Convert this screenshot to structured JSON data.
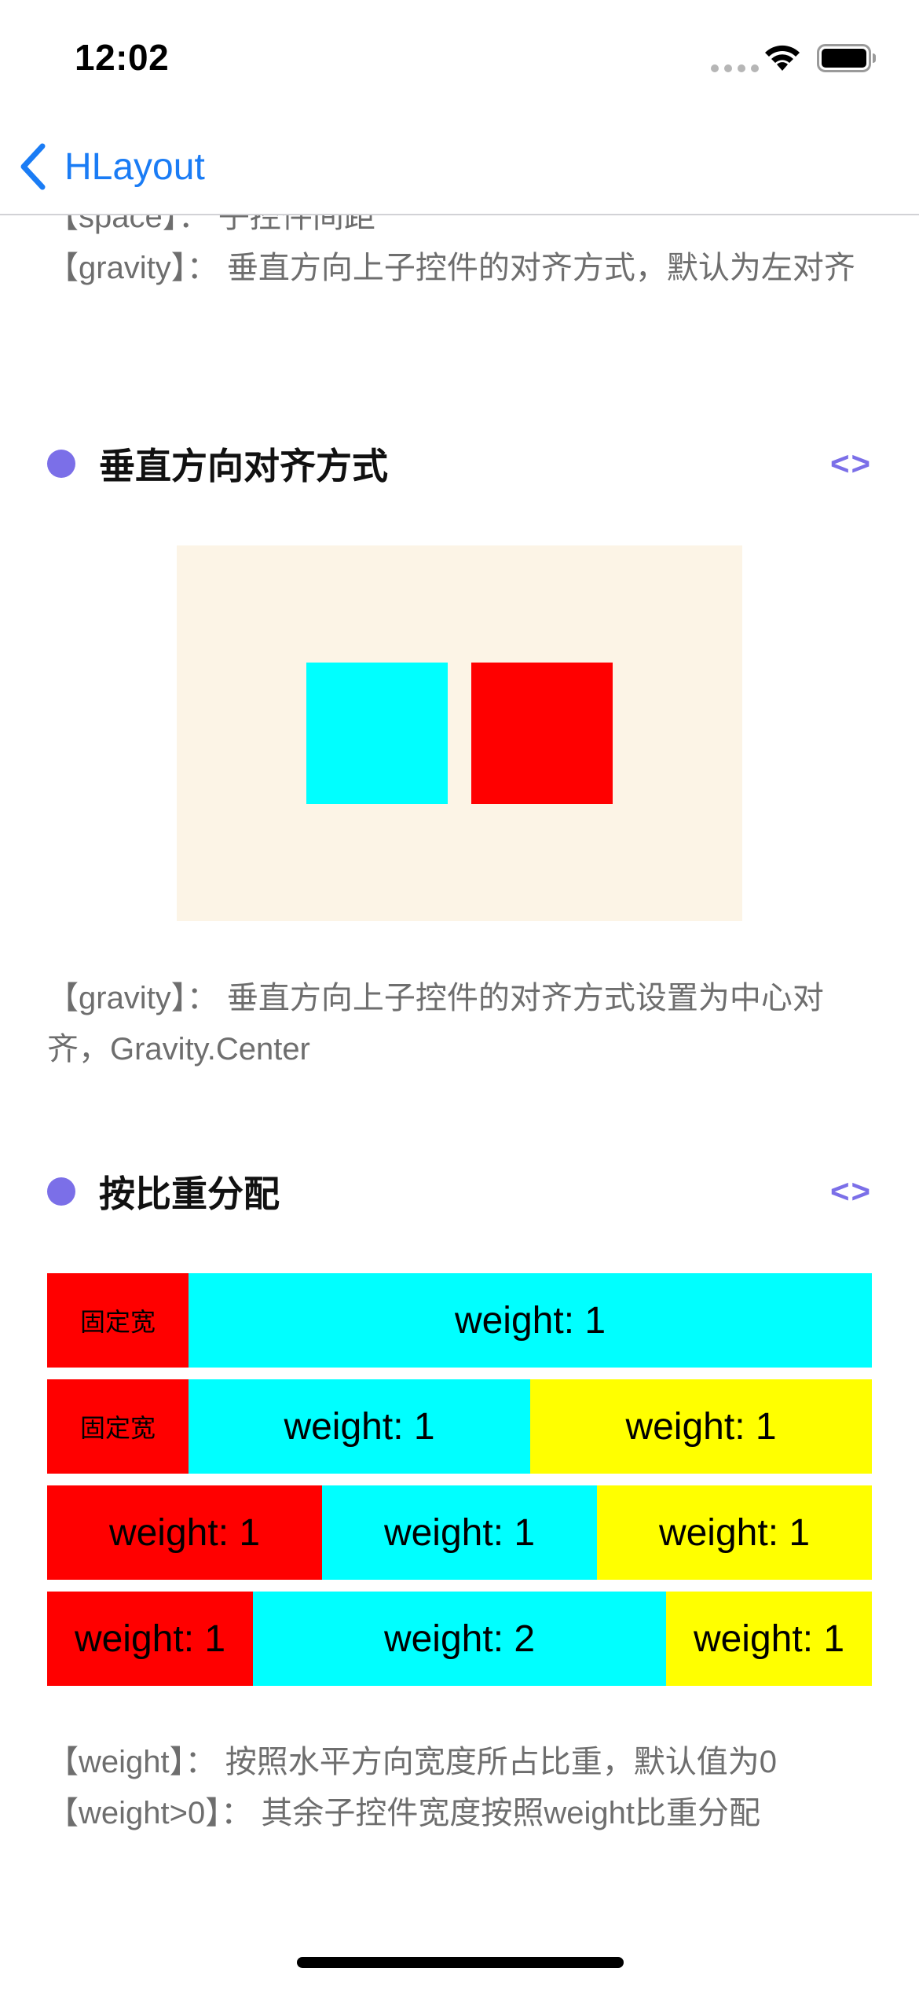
{
  "status_bar": {
    "time": "12:02"
  },
  "nav": {
    "back_label": "HLayout"
  },
  "intro": {
    "lines": [
      "【space】： 子控件间距",
      "【gravity】： 垂直方向上子控件的对齐方式，默认为左对齐"
    ]
  },
  "sections": [
    {
      "title": "垂直方向对齐方式",
      "code_icon": "<>",
      "description": "【gravity】： 垂直方向上子控件的对齐方式设置为中心对齐，Gravity.Center"
    },
    {
      "title": "按比重分配",
      "code_icon": "<>",
      "description_lines": [
        "【weight】： 按照水平方向宽度所占比重，默认值为0",
        "【weight>0】： 其余子控件宽度按照weight比重分配"
      ]
    }
  ],
  "weight_rows": [
    [
      {
        "label": "固定宽",
        "color": "#ff0000"
      },
      {
        "label": "weight: 1",
        "color": "#00ffff"
      }
    ],
    [
      {
        "label": "固定宽",
        "color": "#ff0000"
      },
      {
        "label": "weight: 1",
        "color": "#00ffff"
      },
      {
        "label": "weight: 1",
        "color": "#ffff00"
      }
    ],
    [
      {
        "label": "weight: 1",
        "color": "#ff0000"
      },
      {
        "label": "weight: 1",
        "color": "#00ffff"
      },
      {
        "label": "weight: 1",
        "color": "#ffff00"
      }
    ],
    [
      {
        "label": "weight: 1",
        "color": "#ff0000"
      },
      {
        "label": "weight: 2",
        "color": "#00ffff"
      },
      {
        "label": "weight: 1",
        "color": "#ffff00"
      }
    ]
  ],
  "colors": {
    "accent": "#7b6fe8",
    "link": "#1a7cf5",
    "demo_background": "#fcf4e6",
    "box_cyan": "#00ffff",
    "box_red": "#ff0000"
  }
}
